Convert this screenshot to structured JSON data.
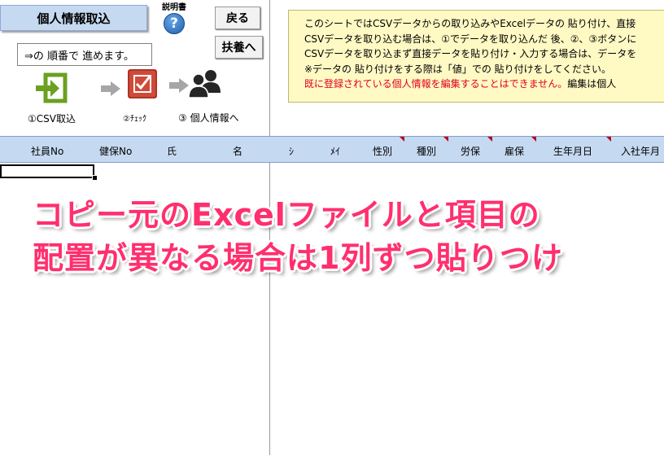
{
  "header": {
    "title": "個人情報取込",
    "help_label": "説明書",
    "help_symbol": "?",
    "back_button": "戻る",
    "fuyou_button": "扶養へ",
    "hint": "⇒の 順番で 進めます。"
  },
  "steps": [
    {
      "label": "①CSV取込",
      "icon": "import-icon"
    },
    {
      "label": "②ﾁｪｯｸ",
      "icon": "check-icon"
    },
    {
      "label": "③ 個人情報へ",
      "icon": "people-icon"
    }
  ],
  "info": {
    "line1": "このシートではCSVデータからの取り込みやExcelデータの 貼り付け、直接",
    "line2": "CSVデータを取り込む場合は、①でデータを取り込んだ 後、②、③ボタンに",
    "line3": "CSVデータを取り込まず直接データを貼り付け・入力する場合は、データを",
    "line4": "※データの 貼り付けをする際は「値」での 貼り付けをしてください。",
    "line5_red": "既に登録されている個人情報を編集することはできません。",
    "line5_black": "編集は個人"
  },
  "columns": [
    "社員No",
    "健保No",
    "氏",
    "名",
    "ｼ",
    "ﾒｲ",
    "性別",
    "種別",
    "労保",
    "雇保",
    "生年月日",
    "入社年月"
  ],
  "overlay": {
    "line1": "コピー元のExcelファイルと項目の",
    "line2": "配置が異なる場合は1列ずつ貼りつけ"
  },
  "colors": {
    "header_blue": "#c5d9f1",
    "info_yellow": "#fff9c4",
    "overlay_pink": "#ff2f6e",
    "warning_red": "#e0001b"
  }
}
